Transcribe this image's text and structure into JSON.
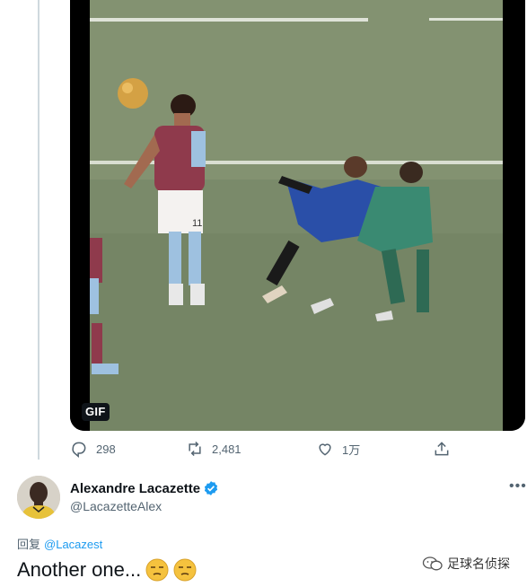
{
  "media": {
    "badge": "GIF",
    "player_number": "11"
  },
  "actions": {
    "reply_count": "298",
    "retweet_count": "2,481",
    "like_count": "1万"
  },
  "author": {
    "name": "Alexandre Lacazette",
    "handle": "@LacazetteAlex",
    "verified": true
  },
  "reply": {
    "prefix": "回复",
    "mention": "@Lacazest"
  },
  "tweet": {
    "text": "Another one..."
  },
  "watermark": {
    "text": "足球名侦探"
  },
  "colors": {
    "accent": "#1d9bf0",
    "muted": "#536471",
    "thread_line": "#cfd9de"
  }
}
